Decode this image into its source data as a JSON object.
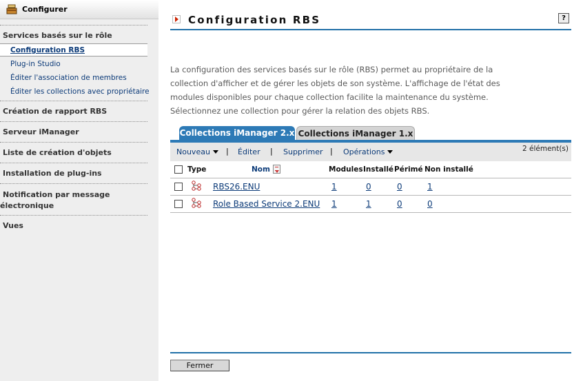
{
  "sidebar": {
    "header_title": "Configurer",
    "categories": [
      {
        "label": "Services basés sur le rôle"
      },
      {
        "label": "Création de rapport RBS"
      },
      {
        "label": "Serveur iManager"
      },
      {
        "label": "Liste de création d'objets"
      },
      {
        "label": "Installation de plug-ins"
      },
      {
        "label": "Notification par message électronique"
      },
      {
        "label": "Vues"
      }
    ],
    "notification_line1": "Notification par message",
    "notification_line2": "électronique",
    "active_item": "Configuration RBS",
    "sub_items": [
      {
        "label": "Plug-in Studio"
      },
      {
        "label": "Éditer l'association de membres"
      },
      {
        "label": "Éditer les collections avec propriétaire"
      }
    ]
  },
  "main": {
    "title": "Configuration RBS",
    "help_label": "?",
    "description": "La configuration des services basés sur le rôle (RBS) permet au propriétaire de la collection d'afficher et de gérer les objets de son système. L'affichage de l'état des modules disponibles pour chaque collection facilite la maintenance du système. Sélectionnez une collection pour gérer la relation des objets RBS.",
    "tabs": [
      {
        "label": "Collections iManager 2.x",
        "active": true
      },
      {
        "label": "Collections iManager 1.x",
        "active": false
      }
    ],
    "toolbar": {
      "nouveau": "Nouveau",
      "editer": "Éditer",
      "supprimer": "Supprimer",
      "operations": "Opérations",
      "separator": "|",
      "count": "2 élément(s)"
    },
    "table": {
      "headers": {
        "type": "Type",
        "nom": "Nom",
        "modules": "Modules",
        "installe": "Installé",
        "perime": "Périmé",
        "non_installe": "Non installé"
      },
      "rows": [
        {
          "name": "RBS26.ENU",
          "modules": "1",
          "installe": "0",
          "perime": "0",
          "non_installe": "1",
          "type_icon": "rbs-collection-icon"
        },
        {
          "name": "Role Based Service 2.ENU",
          "modules": "1",
          "installe": "1",
          "perime": "0",
          "non_installe": "0",
          "type_icon": "rbs-collection-icon"
        }
      ]
    },
    "close_label": "Fermer"
  },
  "colors": {
    "accent": "#2d7ab6",
    "rule": "#1f6fa7",
    "link": "#0b3a78",
    "sidebar_bg": "#eeeeee",
    "toolbar_bg": "#e7e7e7"
  }
}
